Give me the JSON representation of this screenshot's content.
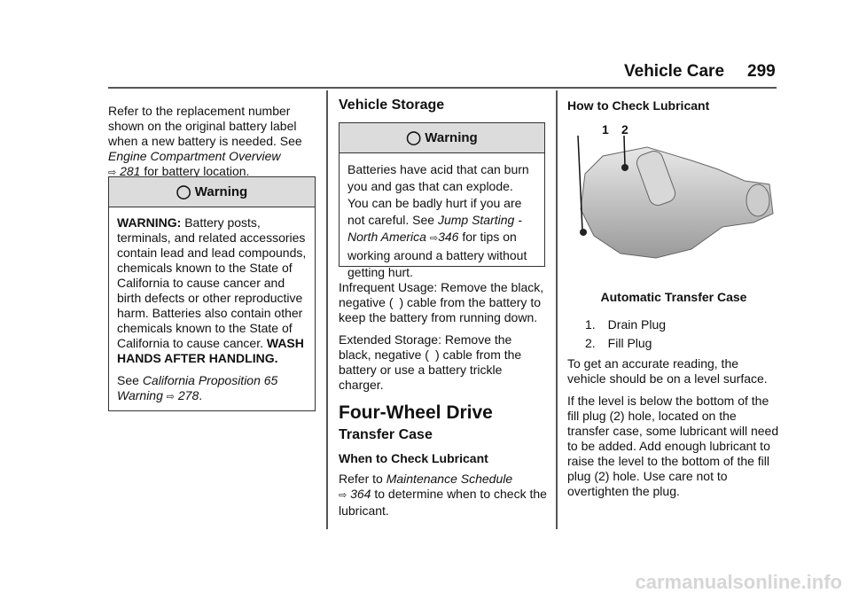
{
  "header": {
    "section": "Vehicle Care",
    "page_number": "299"
  },
  "col1": {
    "intro": "Refer to the replacement number shown on the original battery label when a new battery is needed. See",
    "link": "Engine Compartment Overview",
    "link_page": "281",
    "intro_end": "for battery location.",
    "warning": {
      "title": "Warning",
      "lead": "WARNING:",
      "text": "Battery posts, terminals, and related accessories contain lead and lead compounds, chemicals known to the State of California to cause cancer and birth defects or other reproductive harm. Batteries also contain other chemicals known to the State of California to cause cancer.",
      "bold_end": "WASH HANDS AFTER HANDLING.",
      "see": "See",
      "see_link": "California Proposition 65 Warning",
      "see_page": "278"
    }
  },
  "col2": {
    "heading": "Vehicle Storage",
    "warning": {
      "title": "Warning",
      "text": "Batteries have acid that can burn you and gas that can explode. You can be badly hurt if you are not careful. See",
      "link": "Jump Starting - North America",
      "link_page": "346",
      "text_end": "for tips on working around a battery without getting hurt."
    },
    "p1": "Infrequent Usage: Remove the black, negative ( ) cable from the battery to keep the battery from running down.",
    "p2": "Extended Storage: Remove the black, negative ( ) cable from the battery or use a battery trickle charger.",
    "h1": "Four-Wheel Drive",
    "h2": "Transfer Case",
    "h3": "When to Check Lubricant",
    "p3_start": "Refer to",
    "p3_link": "Maintenance Schedule",
    "p3_page": "364",
    "p3_end": "to determine when to check the lubricant."
  },
  "col3": {
    "heading": "How to Check Lubricant",
    "callouts": [
      "1",
      "2"
    ],
    "caption": "Automatic Transfer Case",
    "list": [
      "1. Drain Plug",
      "2. Fill Plug"
    ],
    "p1": "To get an accurate reading, the vehicle should be on a level surface.",
    "p2": "If the level is below the bottom of the fill plug (2) hole, located on the transfer case, some lubricant will need to be added. Add enough lubricant to raise the level to the bottom of the fill plug (2) hole. Use care not to overtighten the plug."
  },
  "watermark": "carmanualsonline.info",
  "arrow_glyph": "⇨"
}
